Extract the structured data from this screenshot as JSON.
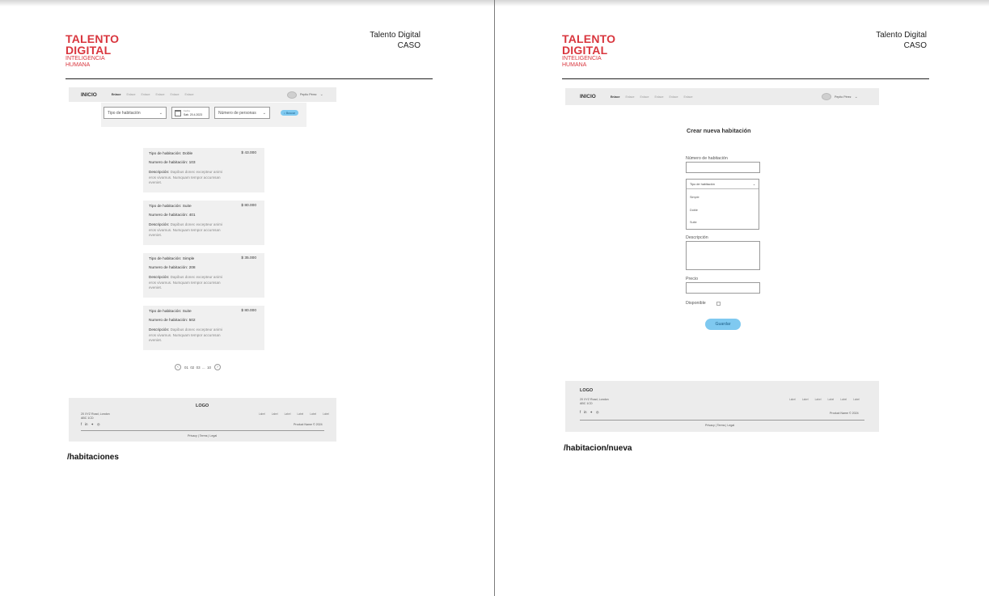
{
  "header": {
    "logo_line1": "TALENTO",
    "logo_line2": "DIGITAL",
    "logo_sub1": "INTELIGENCIA",
    "logo_sub2": "HUMANA",
    "right_line1": "Talento Digital",
    "right_line2": "CASO"
  },
  "nav": {
    "brand": "INICIO",
    "links": [
      "Enlace",
      "Enlace",
      "Enlace",
      "Enlace",
      "Enlace",
      "Enlace"
    ],
    "user_name": "Pepito Pérez"
  },
  "habitaciones": {
    "route": "/habitaciones",
    "search": {
      "tipo_placeholder": "Tipo de habitación",
      "date_label": "Fecha",
      "date_value": "Sab. 20.4.2023",
      "personas_placeholder": "Número de personas",
      "buscar": "Buscar"
    },
    "rooms": [
      {
        "tipo": "Tipo de habitación: Doble",
        "numero": "Numero de habitación: 103",
        "precio": "$ 43.000",
        "desc_label": "Descripción:",
        "desc": "Dapibus donec excepteur animi eros vivamus. Numquam tempor accumsan eveniet."
      },
      {
        "tipo": "Tipo de habitación: Suite",
        "numero": "Numero de habitación: 401",
        "precio": "$ 80.000",
        "desc_label": "Descripción:",
        "desc": "Dapibus donec excepteur animi eros vivamus. Numquam tempor accumsan eveniet."
      },
      {
        "tipo": "Tipo de habitación: Simple",
        "numero": "Numero de habitación: 208",
        "precio": "$ 35.000",
        "desc_label": "Descripción:",
        "desc": "Dapibus donec excepteur animi eros vivamus. Numquam tempor accumsan eveniet."
      },
      {
        "tipo": "Tipo de habitación: Suite",
        "numero": "Numero de habitación: 502",
        "precio": "$ 80.000",
        "desc_label": "Descripción:",
        "desc": "Dapibus donec excepteur animi eros vivamus. Numquam tempor accumsan eveniet."
      }
    ],
    "pagination": "01  02  03  ...  10"
  },
  "nueva": {
    "route": "/habitacion/nueva",
    "title": "Crear nueva habitación",
    "numero_label": "Número de habitación",
    "tipo_placeholder": "Tipo de habitación",
    "tipo_options": [
      "Simple",
      "Doble",
      "Suite"
    ],
    "descripcion_label": "Descripción",
    "precio_label": "Precio",
    "disponible_label": "Disponible",
    "guardar": "Guardar"
  },
  "footer": {
    "logo": "LOGO",
    "address_line1": "20 XYZ Road, London",
    "address_line2": "ABC 1CD",
    "social": [
      "f",
      "in",
      "✦",
      "◎"
    ],
    "links": [
      "Label",
      "Label",
      "Label",
      "Label",
      "Label",
      "Label"
    ],
    "copyright": "Product Name © 2024",
    "legal": "Privacy | Terms | Legal"
  },
  "colors": {
    "brand_red": "#d9363e",
    "accent_blue": "#7fc9f0",
    "panel_gray": "#ececec"
  }
}
